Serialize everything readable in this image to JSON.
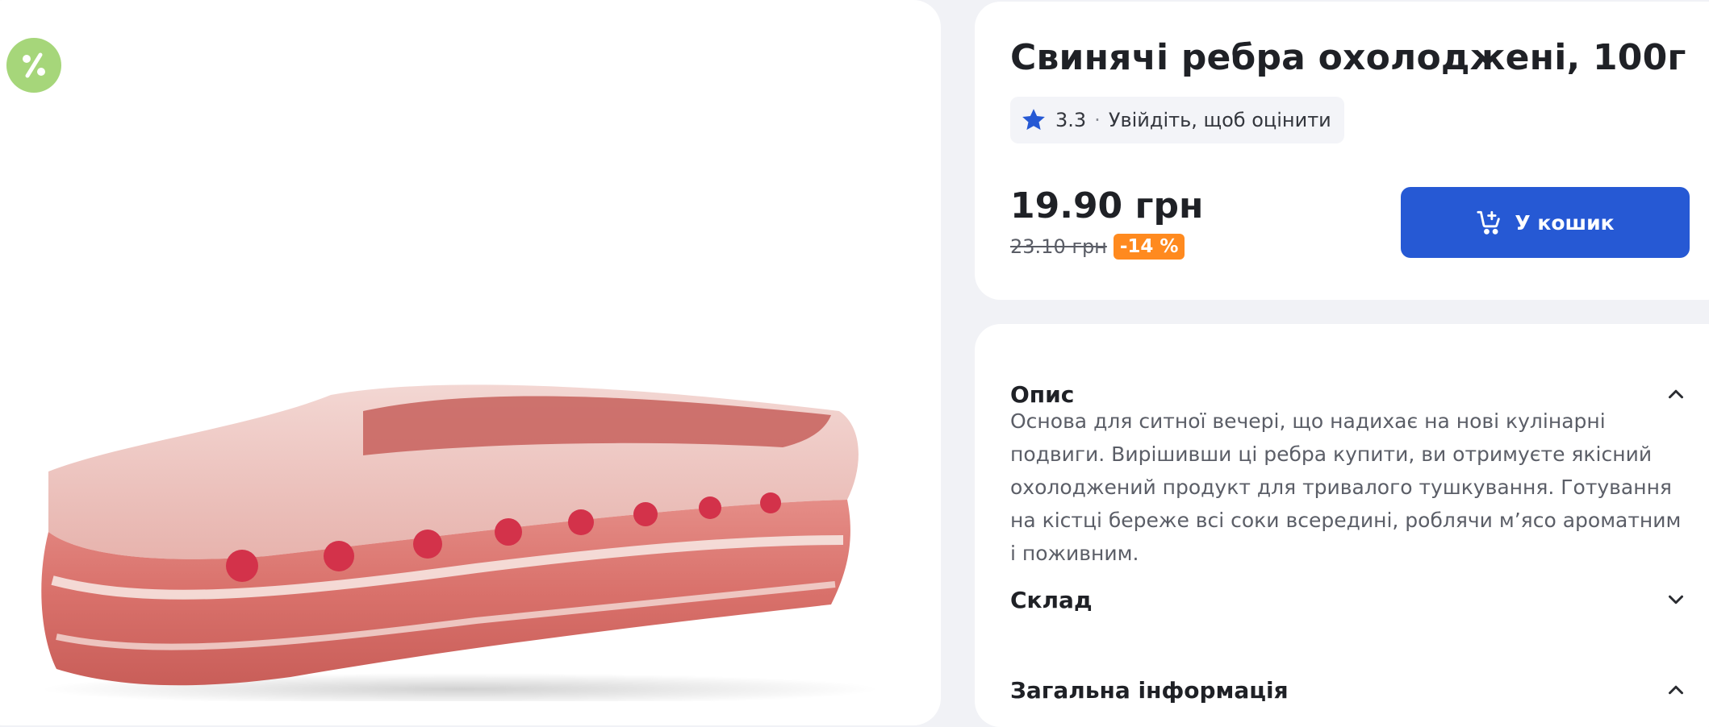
{
  "product": {
    "title": "Свинячі ребра охолоджені, 100г",
    "rating": "3.3",
    "rating_separator": "·",
    "rating_prompt": "Увійдіть, щоб оцінити",
    "price": "19.90 грн",
    "old_price": "23.10 грн",
    "discount": "-14 %",
    "add_to_cart_label": "У кошик"
  },
  "badge": {
    "icon": "percent-icon",
    "color": "#a6d67a"
  },
  "sections": [
    {
      "title": "Опис",
      "expanded": true,
      "icon": "chevron-up-icon",
      "text": "Основа для ситної вечері, що надихає на нові кулінарні подвиги. Вирішивши ці ребра купити, ви отримуєте якісний охолоджений продукт для тривалого тушкування. Готування на кістці береже всі соки всередині, роблячи м’ясо ароматним і поживним."
    },
    {
      "title": "Склад",
      "expanded": false,
      "icon": "chevron-down-icon"
    },
    {
      "title": "Загальна інформація",
      "expanded": true,
      "icon": "chevron-up-icon"
    }
  ],
  "colors": {
    "accent": "#2659d4",
    "discount": "#ff8a1f",
    "star": "#2659d4",
    "background": "#f1f2f6"
  }
}
